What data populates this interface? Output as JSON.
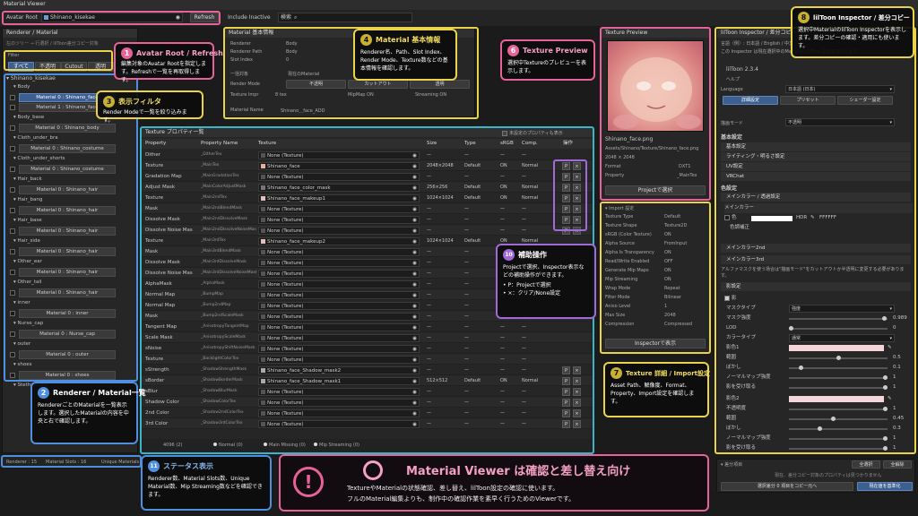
{
  "window": {
    "title": "Material Viewer"
  },
  "toolbar": {
    "avatar_root_label": "Avatar Root",
    "avatar_root_value": "Shinano_kisekae",
    "refresh": "Refresh",
    "include_inactive": "Include Inactive",
    "search_placeholder": "検索"
  },
  "left": {
    "header": "Renderer / Material",
    "subtitle": "左のツリー → 行選択 / lilToon差分コピー対象",
    "filter_label": "Filter",
    "filters": [
      "すべて",
      "不透明",
      "Cutout",
      "透明"
    ],
    "root": "Shinano_kisekae",
    "groups": [
      {
        "name": "Body",
        "items": [
          "Material 0 : Shinano_face",
          "Material 1 : Shinano_face"
        ]
      },
      {
        "name": "Body_base",
        "items": [
          "Material 0 : Shinano_body"
        ]
      },
      {
        "name": "Cloth_under_bra",
        "items": [
          "Material 0 : Shinano_costume"
        ]
      },
      {
        "name": "Cloth_under_shorts",
        "items": [
          "Material 0 : Shinano_costume"
        ]
      },
      {
        "name": "Hair_back",
        "items": [
          "Material 0 : Shinano_hair"
        ]
      },
      {
        "name": "Hair_bang",
        "items": [
          "Material 0 : Shinano_hair"
        ]
      },
      {
        "name": "Hair_base",
        "items": [
          "Material 0 : Shinano_hair"
        ]
      },
      {
        "name": "Hair_side",
        "items": [
          "Material 0 : Shinano_hair"
        ]
      },
      {
        "name": "Other_ear",
        "items": [
          "Material 0 : Shinano_hair"
        ]
      },
      {
        "name": "Other_tail",
        "items": [
          "Material 0 : Shinano_hair"
        ]
      },
      {
        "name": "inner",
        "items": [
          "Material 0 : inner"
        ]
      },
      {
        "name": "Nurse_cap",
        "items": [
          "Material 0 : Nurse_cap"
        ]
      },
      {
        "name": "outer",
        "items": [
          "Material 0 : outer"
        ]
      },
      {
        "name": "shoes",
        "items": [
          "Material 0 : shoes"
        ]
      },
      {
        "name": "Stethoscope",
        "items": []
      }
    ]
  },
  "basic": {
    "header": "Material 基本情報",
    "tab": "Material 基本情報",
    "rows": [
      {
        "k": "Renderer",
        "v": "Body"
      },
      {
        "k": "Renderer Path",
        "v": "Body"
      },
      {
        "k": "Slot Index",
        "v": "0"
      }
    ],
    "ichiran": "一括対象",
    "ichiran_v": "現在のMaterial",
    "render_mode_label": "Render Mode",
    "render_modes": [
      "不透明",
      "カットアウト",
      "透明"
    ],
    "tex_impr_label": "Texture Impr",
    "tex_impr_v": "8 tex",
    "mipmap": "MipMap  ON",
    "streaming": "Streaming  ON",
    "mat_name_label": "Material Name",
    "mat_name_v": "Shinano＿face_ADD"
  },
  "props": {
    "header": "Texture プロパティ一覧",
    "show_unset": "未設定のプロパティも表示",
    "cols": [
      "Property",
      "Property Name",
      "Texture",
      "Size",
      "Type",
      "sRGB",
      "Comp.",
      "操作"
    ],
    "rows": [
      {
        "p": "Dither",
        "n": "_DitherTex",
        "t": "None (Texture)",
        "s": "—",
        "ty": "—",
        "sr": "—",
        "c": "—",
        "btn": false,
        "c1": ""
      },
      {
        "p": "Texture",
        "n": "_MainTex",
        "t": "Shinano_face",
        "s": "2048×2048",
        "ty": "Default",
        "sr": "ON",
        "c": "Normal",
        "btn": true,
        "c1": "#e8b0a0"
      },
      {
        "p": "Gradation Map",
        "n": "_MainGradationTex",
        "t": "None (Texture)",
        "s": "—",
        "ty": "—",
        "sr": "—",
        "c": "—",
        "btn": true,
        "c1": ""
      },
      {
        "p": "Adjust Mask",
        "n": "_MainColorAdjustMask",
        "t": "Shinano_face_color_mask",
        "s": "256×256",
        "ty": "Default",
        "sr": "ON",
        "c": "Normal",
        "btn": true,
        "c1": "#777777"
      },
      {
        "p": "Texture",
        "n": "_Main2ndTex",
        "t": "Shinano_face_makeup1",
        "s": "1024×1024",
        "ty": "Default",
        "sr": "ON",
        "c": "Normal",
        "btn": true,
        "c1": "#e0c0c0"
      },
      {
        "p": "Mask",
        "n": "_Main2ndBlendMask",
        "t": "None (Texture)",
        "s": "—",
        "ty": "—",
        "sr": "—",
        "c": "—",
        "btn": true,
        "c1": ""
      },
      {
        "p": "Dissolve Mask",
        "n": "_Main2ndDissolveMask",
        "t": "None (Texture)",
        "s": "—",
        "ty": "—",
        "sr": "—",
        "c": "—",
        "btn": true,
        "c1": ""
      },
      {
        "p": "Dissolve Noise Mas",
        "n": "_Main2ndDissolveNoiseMask",
        "t": "None (Texture)",
        "s": "—",
        "ty": "—",
        "sr": "—",
        "c": "—",
        "btn": true,
        "c1": ""
      },
      {
        "p": "Texture",
        "n": "_Main3rdTex",
        "t": "Shinano_face_makeup2",
        "s": "1024×1024",
        "ty": "Default",
        "sr": "ON",
        "c": "Normal",
        "btn": false,
        "c1": "#e0c0c0"
      },
      {
        "p": "Mask",
        "n": "_Main3rdBlendMask",
        "t": "None (Texture)",
        "s": "—",
        "ty": "—",
        "sr": "—",
        "c": "—",
        "btn": false,
        "c1": ""
      },
      {
        "p": "Dissolve Mask",
        "n": "_Main3rdDissolveMask",
        "t": "None (Texture)",
        "s": "—",
        "ty": "—",
        "sr": "—",
        "c": "—",
        "btn": false,
        "c1": ""
      },
      {
        "p": "Dissolve Noise Mas",
        "n": "_Main3rdDissolveNoiseMask",
        "t": "None (Texture)",
        "s": "—",
        "ty": "—",
        "sr": "—",
        "c": "—",
        "btn": false,
        "c1": ""
      },
      {
        "p": "AlphaMask",
        "n": "_AlphaMask",
        "t": "None (Texture)",
        "s": "—",
        "ty": "—",
        "sr": "—",
        "c": "—",
        "btn": false,
        "c1": ""
      },
      {
        "p": "Normal Map",
        "n": "_BumpMap",
        "t": "None (Texture)",
        "s": "—",
        "ty": "—",
        "sr": "—",
        "c": "—",
        "btn": false,
        "c1": ""
      },
      {
        "p": "Normal Map",
        "n": "_Bump2ndMap",
        "t": "None (Texture)",
        "s": "—",
        "ty": "—",
        "sr": "—",
        "c": "—",
        "btn": false,
        "c1": ""
      },
      {
        "p": "Mask",
        "n": "_Bump2ndScaleMask",
        "t": "None (Texture)",
        "s": "—",
        "ty": "—",
        "sr": "—",
        "c": "—",
        "btn": false,
        "c1": ""
      },
      {
        "p": "Tangent Map",
        "n": "_AnisotropyTangentMap",
        "t": "None (Texture)",
        "s": "—",
        "ty": "—",
        "sr": "—",
        "c": "—",
        "btn": false,
        "c1": ""
      },
      {
        "p": "Scale Mask",
        "n": "_AnisotropyScaleMask",
        "t": "None (Texture)",
        "s": "—",
        "ty": "—",
        "sr": "—",
        "c": "—",
        "btn": false,
        "c1": ""
      },
      {
        "p": "sNoise",
        "n": "_AnisotropyShiftNoiseMask",
        "t": "None (Texture)",
        "s": "—",
        "ty": "—",
        "sr": "—",
        "c": "—",
        "btn": false,
        "c1": ""
      },
      {
        "p": "Texture",
        "n": "_BacklightColorTex",
        "t": "None (Texture)",
        "s": "—",
        "ty": "—",
        "sr": "—",
        "c": "—",
        "btn": false,
        "c1": ""
      },
      {
        "p": "sStrength",
        "n": "_ShadowStrengthMask",
        "t": "Shinano_face_Shadow_mask2",
        "s": "—",
        "ty": "—",
        "sr": "—",
        "c": "—",
        "btn": true,
        "c1": "#aaaaaa"
      },
      {
        "p": "sBorder",
        "n": "_ShadowBorderMask",
        "t": "Shinano_face_Shadow_mask1",
        "s": "512×512",
        "ty": "Default",
        "sr": "ON",
        "c": "Normal",
        "btn": true,
        "c1": "#aaaaaa"
      },
      {
        "p": "sBlur",
        "n": "_ShadowBlurMask",
        "t": "None (Texture)",
        "s": "—",
        "ty": "—",
        "sr": "—",
        "c": "—",
        "btn": true,
        "c1": ""
      },
      {
        "p": "Shadow Color",
        "n": "_ShadowColorTex",
        "t": "None (Texture)",
        "s": "—",
        "ty": "—",
        "sr": "—",
        "c": "—",
        "btn": true,
        "c1": ""
      },
      {
        "p": "2nd Color",
        "n": "_Shadow2ndColorTex",
        "t": "None (Texture)",
        "s": "—",
        "ty": "—",
        "sr": "—",
        "c": "—",
        "btn": true,
        "c1": ""
      },
      {
        "p": "3rd Color",
        "n": "_Shadow3rdColorTex",
        "t": "None (Texture)",
        "s": "—",
        "ty": "—",
        "sr": "—",
        "c": "—",
        "btn": true,
        "c1": ""
      }
    ],
    "footer": [
      {
        "label": "4096 (2)",
        "color": ""
      },
      {
        "label": "Normal (0)",
        "color": "#dddddd"
      },
      {
        "label": "Main Missing (0)",
        "color": "#dddddd"
      },
      {
        "label": "Mip Streaming (0)",
        "color": "#dddddd"
      }
    ]
  },
  "preview": {
    "header": "Texture Preview",
    "name": "Shinano_face.png",
    "path": "Assets/Shinano/Texture/Shinano_face.png",
    "size": "2048 × 2048",
    "format_label": "Format",
    "format_v": "DXT1",
    "property_label": "Property",
    "property_v": "_MainTex",
    "select_btn": "Projectで選択"
  },
  "import": {
    "header": "Import 設定",
    "rows": [
      {
        "k": "Texture Type",
        "v": "Default"
      },
      {
        "k": "Texture Shape",
        "v": "Texture2D"
      },
      {
        "k": "sRGB (Color Texture)",
        "v": "ON"
      },
      {
        "k": "Alpha Source",
        "v": "FromInput"
      },
      {
        "k": "Alpha Is Transparency",
        "v": "ON"
      },
      {
        "k": "Read/Write Enabled",
        "v": "OFF"
      },
      {
        "k": "Generate Mip Maps",
        "v": "ON"
      },
      {
        "k": "Mip Streaming",
        "v": "ON"
      },
      {
        "k": "Wrap Mode",
        "v": "Repeat"
      },
      {
        "k": "Filter Mode",
        "v": "Bilinear"
      },
      {
        "k": "Aniso Level",
        "v": "1"
      },
      {
        "k": "Max Size",
        "v": "2048"
      },
      {
        "k": "Compression",
        "v": "Compressed"
      }
    ],
    "inspector_btn": "Inspectorで表示"
  },
  "lil": {
    "header": "lilToon Inspector / 差分コピー",
    "lang_note": "言語（例）: 日本語 / English / 中文",
    "lilnote": "この Inspector は現在選択中のMaterialのlilToon設定を表示します。",
    "version": "lilToon 2.3.4",
    "help": "ヘルプ",
    "lang_label": "Language",
    "lang_v": "日本語 (日本)",
    "tabs": [
      "詳細設定",
      "プリセット",
      "シェーダー設定"
    ],
    "render_label": "描画モード",
    "render_v": "不透明",
    "basic_label": "基本設定",
    "sections": [
      "基本設定",
      "ライティング・明るさ設定",
      "UV設定",
      "VRChat"
    ],
    "color_label": "色設定",
    "maincolor": "メインカラー / 透過設定",
    "maincolor_row": "メインカラー",
    "color_name": "色",
    "hdr": "HDR",
    "hex": "FFFFFF",
    "adjust": "色調補正",
    "main2": "メインカラー2nd",
    "main3": "メインカラー3rd",
    "alphamask": "アルファマスクを使う场合は\"描画モード\"をカットアウトか半透明に変更する必要があります。",
    "shadow": "影設定",
    "shadow_on": "影",
    "mask_type_label": "マスクタイプ",
    "mask_type_v": "強度",
    "mask_strength": "マスク強度",
    "mask_strength_v": "0.989",
    "lod": "LOD",
    "lod_v": "0",
    "color_type_label": "カラータイプ",
    "color_type_v": "通常",
    "shadow1": "影色1",
    "range": "範囲",
    "range_v": "0.5",
    "blur": "ぼかし",
    "blur_v": "0.1",
    "nm_strength": "ノーマルマップ強度",
    "nm_v": "1",
    "receive": "影を受け取る",
    "receive_v": "1",
    "shadow2": "影色2",
    "alpha_strength": "不透明度",
    "alpha_v": "1",
    "range2_v": "0.45",
    "blur2_v": "0.3",
    "nm2_v": "1",
    "receive2_v": "1",
    "diff_label": "差分項目",
    "diff_note": "現在、差分コピー対象のプロパティは見つかりません",
    "select_all": "全選択",
    "deselect_all": "全解除",
    "copy_btn": "選択差分 0 項目をコピー元へ",
    "apply_btn": "現在値を基準化"
  },
  "status": {
    "renderer": "Renderer : 15",
    "slots": "Material Slots : 16",
    "unique": "Unique Materials"
  },
  "annotations": {
    "a1": {
      "num": "1",
      "title": "Avatar Root / Refresh",
      "body": "編集対象のAvatar Rootを指定します。Refreshで一覧を再取得します。"
    },
    "a2": {
      "num": "2",
      "title": "Renderer / Material一覧",
      "body": "RendererごとのMaterialを一覧表示します。選択したMaterialの内容を中央と右で確認します。"
    },
    "a3": {
      "num": "3",
      "title": "表示フィルタ",
      "body": "Render Modeで一覧を絞り込みます。"
    },
    "a4": {
      "num": "4",
      "title": "Material 基本情報",
      "body": "Renderer名、Path、Slot Index、Render Mode、Texture数などの基本情報を確認します。"
    },
    "a6": {
      "num": "6",
      "title": "Texture Preview",
      "body": "選択中Textureのプレビューを表示します。"
    },
    "a7": {
      "num": "7",
      "title": "Texture 詳細 / Import設定",
      "body": "Asset Path、解像度、Format、Property、Import設定を確認します。"
    },
    "a8": {
      "num": "8",
      "title": "lilToon Inspector / 差分コピー",
      "body": "選択中MaterialのlilToon Inspectorを表示します。差分コピーの確認・適用にも使います。"
    },
    "a10": {
      "num": "10",
      "title": "補助操作",
      "body": "Projectで選択、Inspector表示などの補助操作ができます。",
      "list": [
        "P：Projectで選択",
        "×：クリア/None設定"
      ]
    },
    "a11": {
      "num": "11",
      "title": "ステータス表示",
      "body": "Renderer数、Material Slots数、Unique Material数、Mip Streaming数などを確認できます。"
    }
  },
  "banner": {
    "title": "Material Viewer は確認と差し替え向け",
    "line1": "TextureやMaterialの状態確認、差し替え、lilToon設定の確認に使います。",
    "line2": "フルのMaterial編集よりも、制作中の確認作業を素早く行うためのViewerです。"
  },
  "colors": {
    "pink": "#e8629a",
    "yellow": "#e8d34a",
    "blue": "#4f8fe0",
    "cyan": "#39b5c8",
    "purple": "#a06bd8",
    "orange": "#e8a040"
  }
}
